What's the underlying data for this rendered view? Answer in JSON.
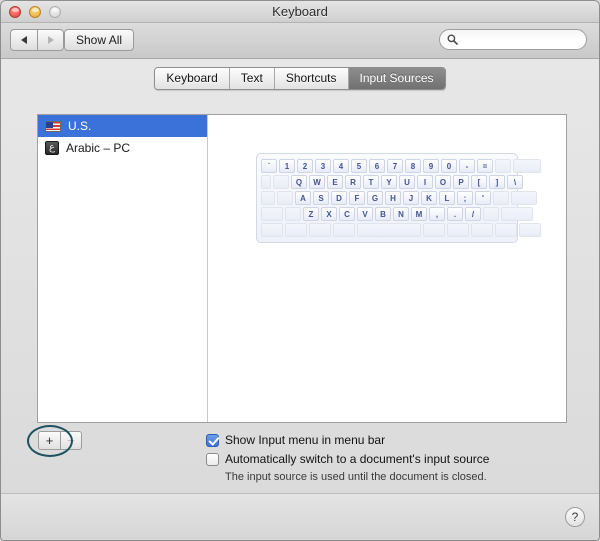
{
  "window": {
    "title": "Keyboard",
    "traffic_lights": [
      "close-button",
      "minimize-button",
      "zoom-button"
    ]
  },
  "toolbar": {
    "back_label": "back-arrow",
    "forward_label": "forward-arrow",
    "show_all_label": "Show All",
    "search": {
      "value": "",
      "placeholder": ""
    }
  },
  "tabs": [
    {
      "label": "Keyboard",
      "active": false
    },
    {
      "label": "Text",
      "active": false
    },
    {
      "label": "Shortcuts",
      "active": false
    },
    {
      "label": "Input Sources",
      "active": true
    }
  ],
  "input_sources": [
    {
      "label": "U.S.",
      "icon": "us-flag-icon",
      "selected": true
    },
    {
      "label": "Arabic – PC",
      "icon": "arabic-keyboard-icon",
      "glyph": "ع",
      "selected": false
    }
  ],
  "keyboard_preview": {
    "rows": [
      [
        "`",
        "1",
        "2",
        "3",
        "4",
        "5",
        "6",
        "7",
        "8",
        "9",
        "0",
        "-",
        "=",
        " "
      ],
      [
        " ",
        "Q",
        "W",
        "E",
        "R",
        "T",
        "Y",
        "U",
        "I",
        "O",
        "P",
        "[",
        "]",
        "\\"
      ],
      [
        " ",
        "A",
        "S",
        "D",
        "F",
        "G",
        "H",
        "J",
        "K",
        "L",
        ";",
        "'",
        " "
      ],
      [
        " ",
        "Z",
        "X",
        "C",
        "V",
        "B",
        "N",
        "M",
        ",",
        ".",
        "/",
        " "
      ],
      [
        " ",
        " ",
        " ",
        " ",
        " ",
        " ",
        " ",
        " ",
        " ",
        " "
      ]
    ]
  },
  "list_controls": {
    "add_label": "+",
    "remove_label": "−"
  },
  "options": [
    {
      "label": "Show Input menu in menu bar",
      "checked": true
    },
    {
      "label": "Automatically switch to a document's input source",
      "checked": false
    }
  ],
  "hint": "The input source is used until the document is closed.",
  "help": {
    "label": "?"
  },
  "colors": {
    "selection_blue": "#3b72d9",
    "active_tab": "#717171",
    "annotation": "#20525e",
    "key_text": "#44548f"
  }
}
